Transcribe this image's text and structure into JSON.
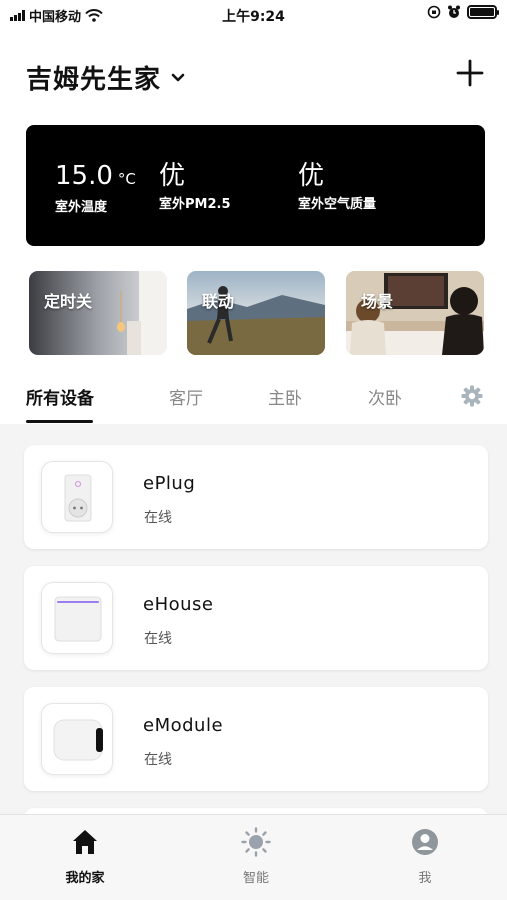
{
  "status_bar": {
    "carrier": "中国移动",
    "time": "上午9:24"
  },
  "header": {
    "home_name": "吉姆先生家"
  },
  "weather": {
    "temperature": {
      "value": "15.0",
      "unit": "°C",
      "label": "室外温度"
    },
    "pm25": {
      "value": "优",
      "label": "室外PM2.5"
    },
    "air_quality": {
      "value": "优",
      "label": "室外空气质量"
    }
  },
  "cards": [
    {
      "label": "定时关"
    },
    {
      "label": "联动"
    },
    {
      "label": "场景"
    }
  ],
  "tabs": [
    "所有设备",
    "客厅",
    "主卧",
    "次卧"
  ],
  "devices": [
    {
      "name": "ePlug",
      "status": "在线",
      "icon": "smart-plug-icon"
    },
    {
      "name": "eHouse",
      "status": "在线",
      "icon": "wall-switch-icon"
    },
    {
      "name": "eModule",
      "status": "在线",
      "icon": "module-icon"
    }
  ],
  "tabbar": [
    {
      "label": "我的家",
      "icon": "home-icon"
    },
    {
      "label": "智能",
      "icon": "sun-icon"
    },
    {
      "label": "我",
      "icon": "user-icon"
    }
  ],
  "colors": {
    "accent": "#000000",
    "background": "#f4f4f4",
    "tab_inactive": "#888888"
  }
}
